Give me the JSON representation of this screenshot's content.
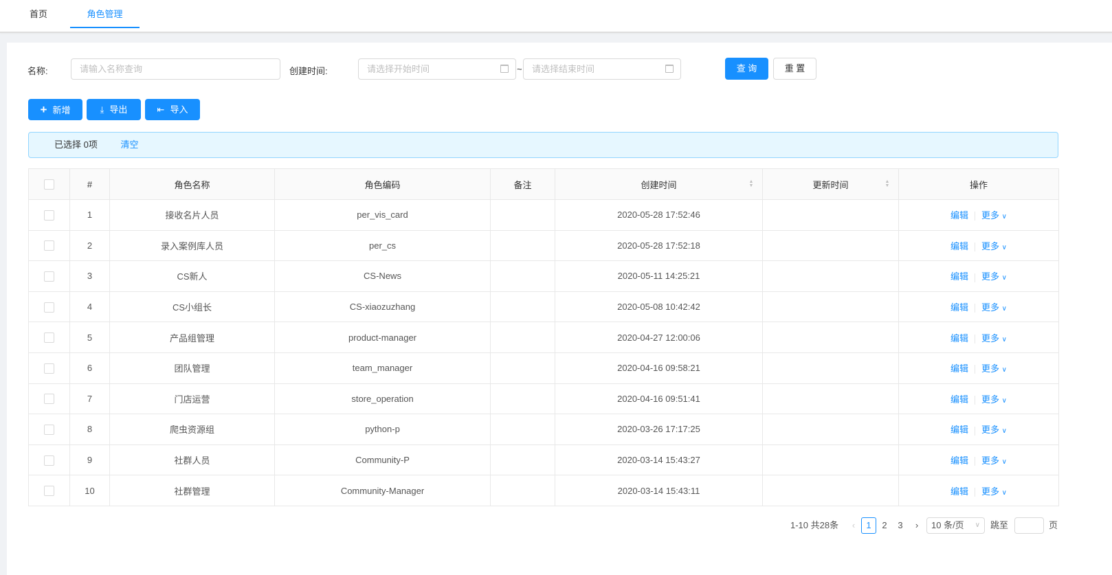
{
  "tabs": [
    {
      "label": "首页"
    },
    {
      "label": "角色管理"
    }
  ],
  "search": {
    "name_label": "名称:",
    "name_placeholder": "请输入名称查询",
    "time_label": "创建时间:",
    "start_placeholder": "请选择开始时间",
    "end_placeholder": "请选择结束时间",
    "range_sep": "~",
    "query": "查 询",
    "reset": "重 置"
  },
  "toolbar": {
    "add": "新增",
    "export": "导出",
    "import": "导入"
  },
  "alert": {
    "selected": "已选择 0项",
    "clear": "清空"
  },
  "table": {
    "columns": [
      "#",
      "角色名称",
      "角色编码",
      "备注",
      "创建时间",
      "更新时间",
      "操作"
    ],
    "edit": "编辑",
    "more": "更多",
    "rows": [
      {
        "no": "1",
        "name": "接收名片人员",
        "code": "per_vis_card",
        "remark": "",
        "created": "2020-05-28 17:52:46",
        "updated": ""
      },
      {
        "no": "2",
        "name": "录入案例库人员",
        "code": "per_cs",
        "remark": "",
        "created": "2020-05-28 17:52:18",
        "updated": ""
      },
      {
        "no": "3",
        "name": "CS新人",
        "code": "CS-News",
        "remark": "",
        "created": "2020-05-11 14:25:21",
        "updated": ""
      },
      {
        "no": "4",
        "name": "CS小组长",
        "code": "CS-xiaozuzhang",
        "remark": "",
        "created": "2020-05-08 10:42:42",
        "updated": ""
      },
      {
        "no": "5",
        "name": "产品组管理",
        "code": "product-manager",
        "remark": "",
        "created": "2020-04-27 12:00:06",
        "updated": ""
      },
      {
        "no": "6",
        "name": "团队管理",
        "code": "team_manager",
        "remark": "",
        "created": "2020-04-16 09:58:21",
        "updated": ""
      },
      {
        "no": "7",
        "name": "门店运营",
        "code": "store_operation",
        "remark": "",
        "created": "2020-04-16 09:51:41",
        "updated": ""
      },
      {
        "no": "8",
        "name": "爬虫资源组",
        "code": "python-p",
        "remark": "",
        "created": "2020-03-26 17:17:25",
        "updated": ""
      },
      {
        "no": "9",
        "name": "社群人员",
        "code": "Community-P",
        "remark": "",
        "created": "2020-03-14 15:43:27",
        "updated": ""
      },
      {
        "no": "10",
        "name": "社群管理",
        "code": "Community-Manager",
        "remark": "",
        "created": "2020-03-14 15:43:11",
        "updated": ""
      }
    ]
  },
  "pagination": {
    "summary": "1-10 共28条",
    "pages": [
      "1",
      "2",
      "3"
    ],
    "page_size": "10 条/页",
    "jump_label": "跳至",
    "page_suffix": "页"
  }
}
